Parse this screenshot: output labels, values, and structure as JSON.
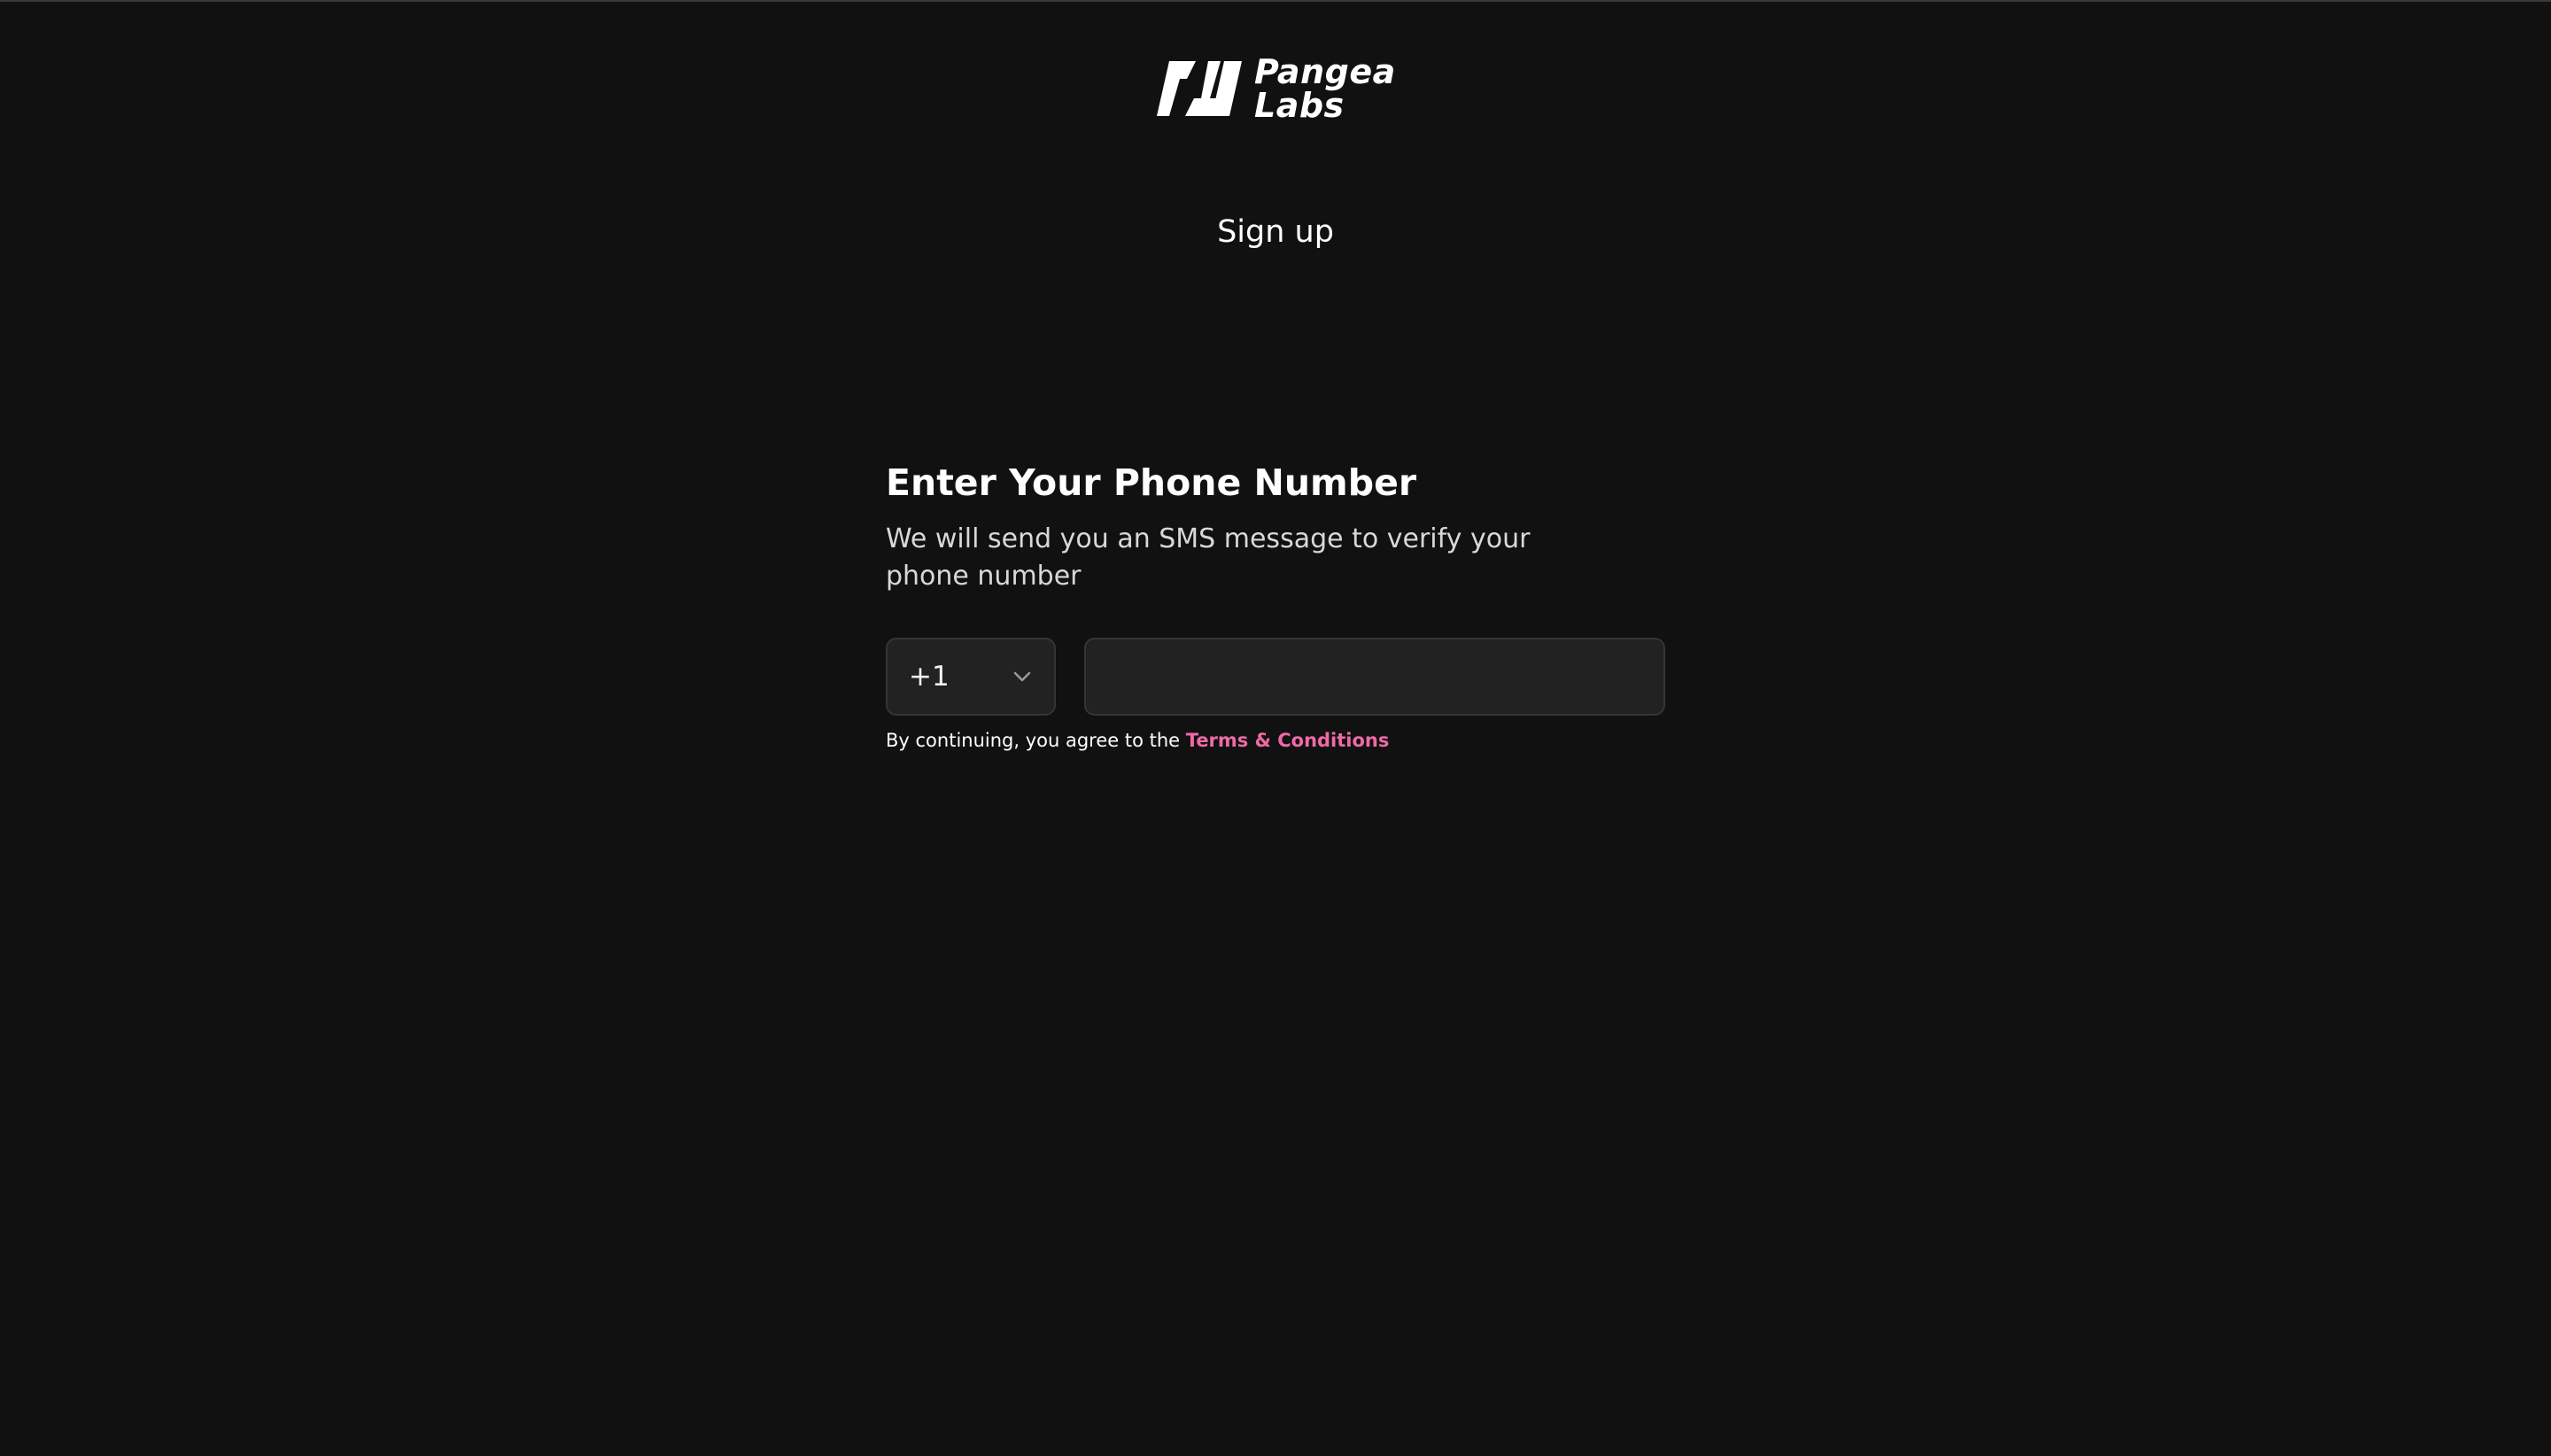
{
  "brand": {
    "line1": "Pangea",
    "line2": "Labs",
    "accent_color": "#ee6aa7"
  },
  "page": {
    "title": "Sign up"
  },
  "form": {
    "heading": "Enter Your Phone Number",
    "subtitle": "We will send you an SMS message to verify your phone number",
    "country_code": "+1",
    "phone_value": "",
    "terms_prefix": "By continuing, you agree to the ",
    "terms_link": "Terms & Conditions"
  },
  "icons": {
    "logo": "pangea-logo-mark",
    "dropdown": "chevron-down-icon"
  }
}
